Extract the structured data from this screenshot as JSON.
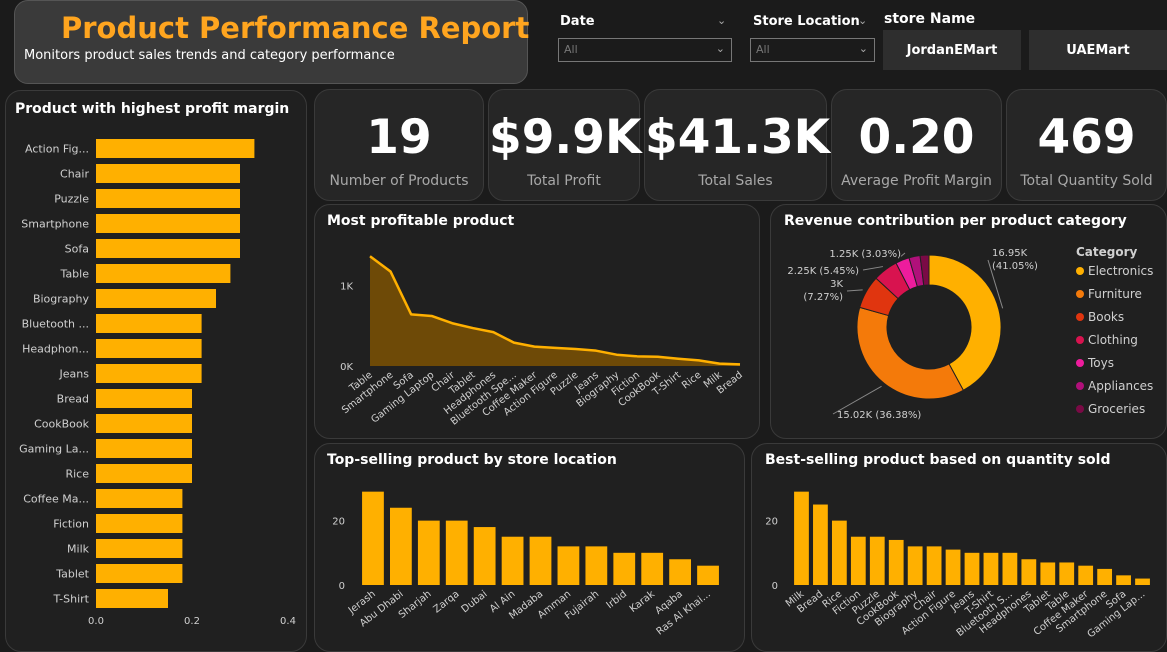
{
  "header": {
    "title": "Product Performance Report",
    "subtitle": "Monitors product sales trends and category performance"
  },
  "filters": {
    "date": {
      "label": "Date",
      "value": "All"
    },
    "store_location": {
      "label": "Store Location",
      "value": "All"
    },
    "store_name": {
      "label": "store Name",
      "buttons": [
        "JordanEMart",
        "UAEMart"
      ]
    }
  },
  "kpis": [
    {
      "value": "19",
      "label": "Number of Products"
    },
    {
      "value": "$9.9K",
      "label": "Total Profit"
    },
    {
      "value": "$41.3K",
      "label": "Total Sales"
    },
    {
      "value": "0.20",
      "label": "Average Profit Margin"
    },
    {
      "value": "469",
      "label": "Total Quantity Sold"
    }
  ],
  "colors": {
    "accent": "#ffa51f",
    "bar": "#ffb000",
    "area_fill": "#6e4a07"
  },
  "chart_data": [
    {
      "id": "profit_margin",
      "type": "bar",
      "orientation": "horizontal",
      "title": "Product with highest profit margin",
      "categories": [
        "Action Fig...",
        "Chair",
        "Puzzle",
        "Smartphone",
        "Sofa",
        "Table",
        "Biography",
        "Bluetooth ...",
        "Headphon...",
        "Jeans",
        "Bread",
        "CookBook",
        "Gaming La...",
        "Rice",
        "Coffee Ma...",
        "Fiction",
        "Milk",
        "Tablet",
        "T-Shirt"
      ],
      "values": [
        0.33,
        0.3,
        0.3,
        0.3,
        0.3,
        0.28,
        0.25,
        0.22,
        0.22,
        0.22,
        0.2,
        0.2,
        0.2,
        0.2,
        0.18,
        0.18,
        0.18,
        0.18,
        0.15
      ],
      "xlim": [
        0,
        0.4
      ],
      "xticks": [
        "0.0",
        "0.2",
        "0.4"
      ]
    },
    {
      "id": "profitable_product",
      "type": "area",
      "title": "Most profitable product",
      "categories": [
        "Table",
        "Smartphone",
        "Sofa",
        "Gaming Laptop",
        "Chair",
        "Tablet",
        "Headphones",
        "Bluetooth Spe...",
        "Coffee Maker",
        "Action Figure",
        "Puzzle",
        "Jeans",
        "Biography",
        "Fiction",
        "CookBook",
        "T-Shirt",
        "Rice",
        "Milk",
        "Bread"
      ],
      "values": [
        1360,
        1170,
        640,
        620,
        530,
        470,
        420,
        290,
        240,
        225,
        210,
        190,
        140,
        120,
        115,
        90,
        70,
        30,
        20
      ],
      "ylim": [
        0,
        1400
      ],
      "yticks": [
        "1K",
        "0K"
      ]
    },
    {
      "id": "category_revenue",
      "type": "pie",
      "donut": true,
      "title": "Revenue contribution per product category",
      "legend_title": "Category",
      "slices": [
        {
          "name": "Electronics",
          "value": 16.95,
          "label": "16.95K (41.05%)",
          "color": "#ffb000"
        },
        {
          "name": "Furniture",
          "value": 15.02,
          "label": "15.02K (36.38%)",
          "color": "#f47a0a"
        },
        {
          "name": "Books",
          "value": 3.0,
          "label": "3K (7.27%)",
          "color": "#e0350f"
        },
        {
          "name": "Clothing",
          "value": 2.25,
          "label": "2.25K (5.45%)",
          "color": "#d8134f"
        },
        {
          "name": "Toys",
          "value": 1.25,
          "label": "1.25K (3.03%)",
          "color": "#ee1c9d"
        },
        {
          "name": "Appliances",
          "value": 1.0,
          "label": "",
          "color": "#b0107a"
        },
        {
          "name": "Groceries",
          "value": 0.8,
          "label": "",
          "color": "#7a0a45"
        }
      ]
    },
    {
      "id": "store_location_sales",
      "type": "bar",
      "title": "Top-selling product by store location",
      "categories": [
        "Jerash",
        "Abu Dhabi",
        "Sharjah",
        "Zarqa",
        "Dubai",
        "Al Ain",
        "Madaba",
        "Amman",
        "Fujairah",
        "Irbid",
        "Karak",
        "Aqaba",
        "Ras Al Khai..."
      ],
      "values": [
        29,
        24,
        20,
        20,
        18,
        15,
        15,
        12,
        12,
        10,
        10,
        8,
        6
      ],
      "ylim": [
        0,
        32
      ],
      "yticks": [
        "20",
        "0"
      ]
    },
    {
      "id": "quantity_sold",
      "type": "bar",
      "title": "Best-selling product based on quantity sold",
      "categories": [
        "Milk",
        "Bread",
        "Rice",
        "Fiction",
        "Puzzle",
        "CookBook",
        "Biography",
        "Chair",
        "Action Figure",
        "Jeans",
        "T-Shirt",
        "Bluetooth S...",
        "Headphones",
        "Tablet",
        "Table",
        "Coffee Maker",
        "Smartphone",
        "Sofa",
        "Gaming Lap..."
      ],
      "values": [
        29,
        25,
        20,
        15,
        15,
        14,
        12,
        12,
        11,
        10,
        10,
        10,
        8,
        7,
        7,
        6,
        5,
        3,
        2
      ],
      "ylim": [
        0,
        32
      ],
      "yticks": [
        "20",
        "0"
      ]
    }
  ]
}
